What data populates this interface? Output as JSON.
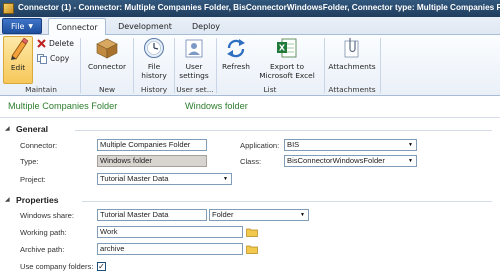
{
  "window": {
    "title": "Connector (1) - Connector: Multiple Companies Folder, BisConnectorWindowsFolder, Connector type: Multiple Companies F"
  },
  "tabs": {
    "file_label": "File",
    "items": [
      {
        "label": "Connector",
        "active": true
      },
      {
        "label": "Development",
        "active": false
      },
      {
        "label": "Deploy",
        "active": false
      }
    ]
  },
  "ribbon": {
    "edit_label": "Edit",
    "delete_label": "Delete",
    "copy_label": "Copy",
    "connector_label": "Connector",
    "file_history_label1": "File",
    "file_history_label2": "history",
    "user_settings_label1": "User",
    "user_settings_label2": "settings",
    "refresh_label": "Refresh",
    "export_label1": "Export to",
    "export_label2": "Microsoft Excel",
    "attachments_label": "Attachments",
    "groups": {
      "maintain": "Maintain",
      "new": "New",
      "history": "History",
      "user_set": "User set...",
      "list": "List",
      "attachments": "Attachments"
    }
  },
  "header": {
    "name": "Multiple Companies Folder",
    "type": "Windows folder"
  },
  "general": {
    "title": "General",
    "connector_label": "Connector:",
    "connector_value": "Multiple Companies Folder",
    "type_label": "Type:",
    "type_value": "Windows folder",
    "project_label": "Project:",
    "project_value": "Tutorial Master Data",
    "application_label": "Application:",
    "application_value": "BIS",
    "class_label": "Class:",
    "class_value": "BisConnectorWindowsFolder"
  },
  "properties": {
    "title": "Properties",
    "windows_share_label": "Windows share:",
    "windows_share_value": "Tutorial Master Data",
    "windows_share_kind": "Folder",
    "working_path_label": "Working path:",
    "working_path_value": "Work",
    "archive_path_label": "Archive path:",
    "archive_path_value": "archive",
    "use_company_folders_label": "Use company folders:",
    "use_company_folders_checked": true
  }
}
